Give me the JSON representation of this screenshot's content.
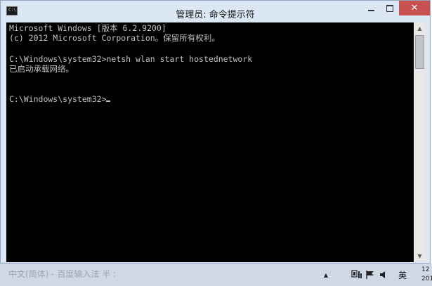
{
  "window": {
    "title": "管理员: 命令提示符",
    "icon_label": "C:\\",
    "min_icon": "minimize-icon",
    "max_icon": "maximize-icon",
    "close_icon": "close-icon",
    "close_label": "✕",
    "close_color": "#c75050"
  },
  "console": {
    "background": "#000000",
    "text_color": "#c0c0c0",
    "lines": [
      "Microsoft Windows [版本 6.2.9200]",
      "(c) 2012 Microsoft Corporation。保留所有权利。",
      "",
      "C:\\Windows\\system32>netsh wlan start hostednetwork",
      "已启动承载网络。",
      "",
      "",
      "C:\\Windows\\system32>"
    ]
  },
  "scrollbar": {
    "up_icon": "scroll-up-icon",
    "down_icon": "scroll-down-icon",
    "up_glyph": "▲",
    "down_glyph": "▼"
  },
  "taskbar": {
    "ime_status": "中文(简体) - 百度输入法 半 :",
    "tray_arrow": "▲",
    "language": "英",
    "clock_line1": "12",
    "clock_line2": "201"
  }
}
